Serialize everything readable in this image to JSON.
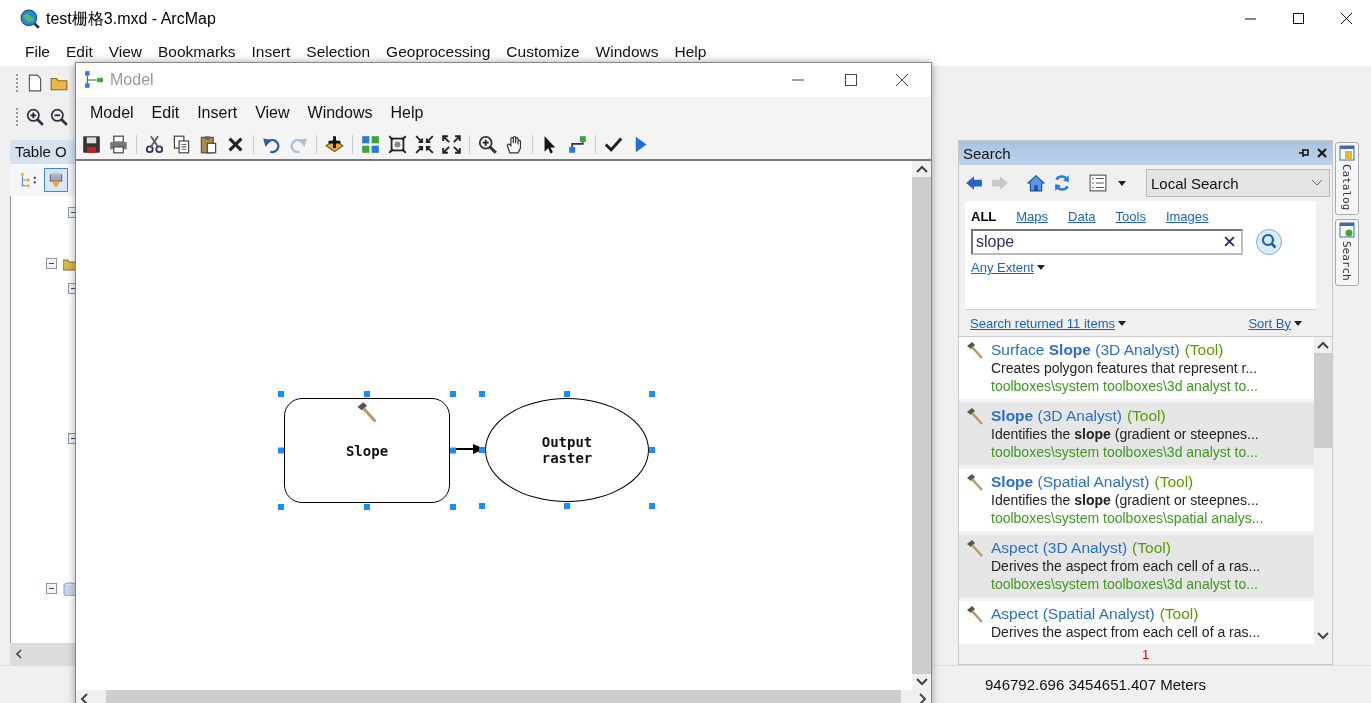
{
  "arcmap": {
    "title": "test栅格3.mxd - ArcMap",
    "active": true,
    "menu": [
      "File",
      "Edit",
      "View",
      "Bookmarks",
      "Insert",
      "Selection",
      "Geoprocessing",
      "Customize",
      "Windows",
      "Help"
    ]
  },
  "toc": {
    "title": "Table O",
    "view_buttons": [
      {
        "kind": "drawing-order",
        "selected": false
      },
      {
        "kind": "source",
        "selected": true
      }
    ],
    "tree": [
      {
        "kind": "layer",
        "expanded": true
      },
      {
        "kind": "folder",
        "expanded": true,
        "children": [
          {
            "expanded": true
          },
          {
            "expanded": true
          }
        ]
      },
      {
        "kind": "database",
        "expanded": true
      }
    ]
  },
  "model": {
    "title": "Model",
    "active": false,
    "menu": [
      "Model",
      "Edit",
      "Insert",
      "View",
      "Windows",
      "Help"
    ],
    "toolbar": [
      {
        "items": [
          {
            "kind": "save",
            "disabled": false
          },
          {
            "kind": "print",
            "disabled": false
          }
        ]
      },
      {
        "items": [
          {
            "kind": "cut",
            "disabled": false
          },
          {
            "kind": "copy",
            "disabled": false
          },
          {
            "kind": "paste",
            "disabled": false
          },
          {
            "kind": "delete",
            "disabled": false
          }
        ]
      },
      {
        "items": [
          {
            "kind": "undo",
            "disabled": false
          },
          {
            "kind": "redo",
            "disabled": true
          }
        ]
      },
      {
        "items": [
          {
            "kind": "add",
            "disabled": false
          }
        ]
      },
      {
        "items": [
          {
            "kind": "layout",
            "disabled": false
          },
          {
            "kind": "full-extent",
            "disabled": false
          },
          {
            "kind": "shrink",
            "disabled": false
          },
          {
            "kind": "expand",
            "disabled": false
          }
        ]
      },
      {
        "items": [
          {
            "kind": "zoom",
            "disabled": false
          },
          {
            "kind": "pan",
            "disabled": false
          }
        ]
      },
      {
        "items": [
          {
            "kind": "select",
            "disabled": false
          },
          {
            "kind": "connect",
            "disabled": false
          }
        ]
      },
      {
        "items": [
          {
            "kind": "validate",
            "disabled": false
          },
          {
            "kind": "run",
            "disabled": false
          }
        ]
      }
    ],
    "diagram": {
      "nodes": [
        {
          "kind": "tool",
          "label": "Slope",
          "selected": true
        },
        {
          "kind": "data",
          "label": "Output raster",
          "selected": true
        }
      ]
    }
  },
  "search": {
    "title": "Search",
    "toolbar": [
      {
        "kind": "back",
        "disabled": false
      },
      {
        "kind": "forward",
        "disabled": true
      },
      {
        "kind": "home",
        "disabled": false
      },
      {
        "kind": "refresh",
        "disabled": false
      }
    ],
    "scope": "Local Search",
    "tabs": [
      {
        "label": "ALL",
        "selected": true
      },
      {
        "label": "Maps",
        "selected": false
      },
      {
        "label": "Data",
        "selected": false
      },
      {
        "label": "Tools",
        "selected": false
      },
      {
        "label": "Images",
        "selected": false
      }
    ],
    "query": "slope",
    "extent": "Any Extent",
    "summary": "Search returned 11 items",
    "sort": "Sort By",
    "results": [
      {
        "title": "Surface **Slope** (3D Analyst)",
        "type": "(Tool)",
        "description": "Creates polygon features that represent r...",
        "path": "toolboxes\\system toolboxes\\3d analyst to..."
      },
      {
        "title": "**Slope** (3D Analyst)",
        "type": "(Tool)",
        "description": "Identifies the **slope** (gradient or steepnes...",
        "path": "toolboxes\\system toolboxes\\3d analyst to..."
      },
      {
        "title": "**Slope** (Spatial Analyst)",
        "type": "(Tool)",
        "description": "Identifies the **slope** (gradient or steepnes...",
        "path": "toolboxes\\system toolboxes\\spatial analys..."
      },
      {
        "title": "Aspect (3D Analyst)",
        "type": "(Tool)",
        "description": "Derives the aspect from each cell of a ras...",
        "path": "toolboxes\\system toolboxes\\3d analyst to..."
      },
      {
        "title": "Aspect (Spatial Analyst)",
        "type": "(Tool)",
        "description": "Derives the aspect from each cell of a ras..."
      }
    ],
    "page": "1"
  },
  "side_tabs": [
    {
      "label": "Catalog"
    },
    {
      "label": "Search"
    }
  ],
  "status_bar": {
    "coordinates": "946792.696  3454651.407 Meters"
  }
}
